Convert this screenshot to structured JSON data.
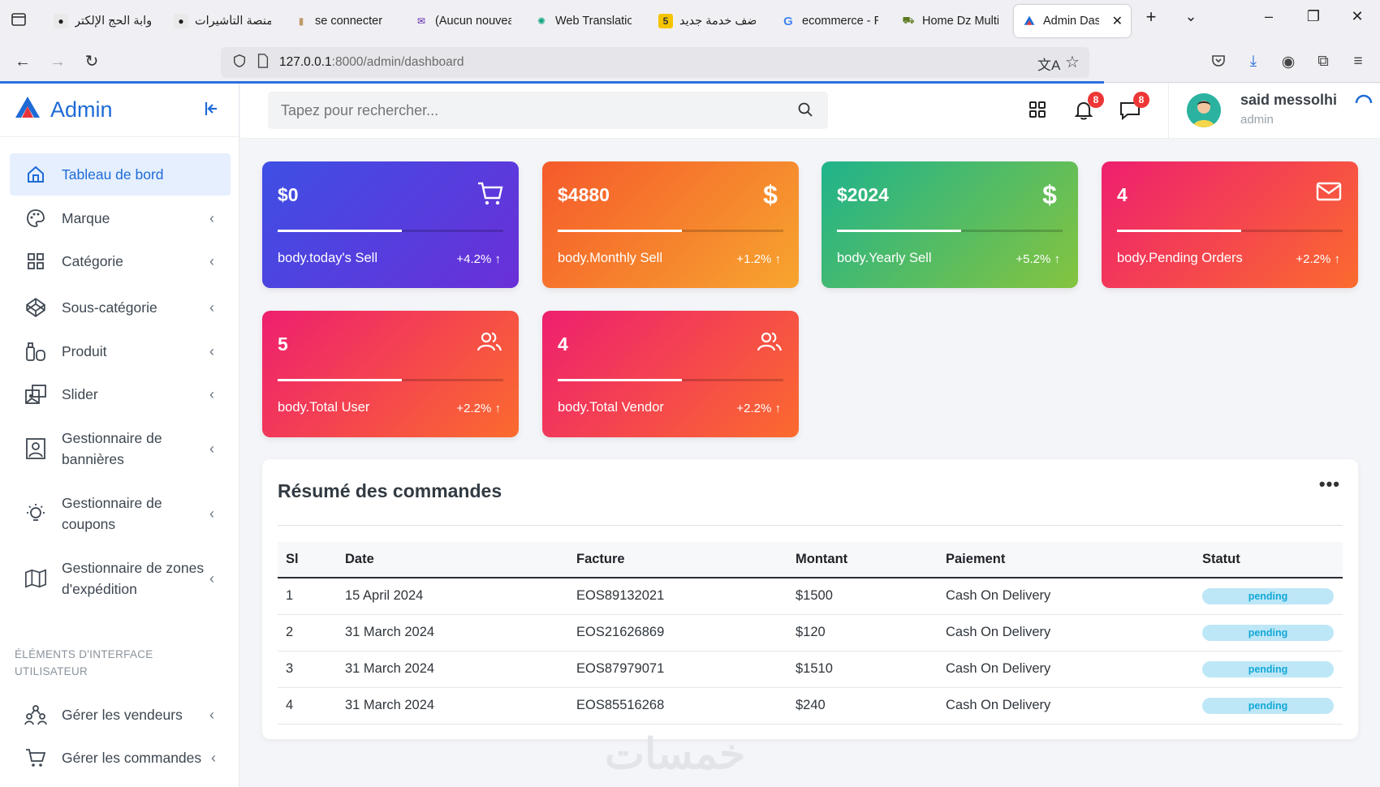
{
  "browser": {
    "tabs": [
      {
        "label": "بوابة الحج الإلكتر",
        "icon": "globe-icon"
      },
      {
        "label": "منصة التأشيرات",
        "icon": "globe-icon"
      },
      {
        "label": "se connecter",
        "icon": "page-icon"
      },
      {
        "label": "(Aucun nouvea",
        "icon": "mail-icon"
      },
      {
        "label": "Web Translation",
        "icon": "chatgpt-icon"
      },
      {
        "label": "أضف خدمة جديد",
        "icon": "khamsat-icon"
      },
      {
        "label": "ecommerce - R",
        "icon": "google-icon"
      },
      {
        "label": "Home Dz Multi",
        "icon": "truck-icon"
      },
      {
        "label": "Admin Dash",
        "icon": "admin-logo-icon"
      }
    ],
    "url_host": "127.0.0.1",
    "url_path": ":8000/admin/dashboard"
  },
  "sidebar": {
    "brand": "Admin",
    "items": [
      {
        "label": "Tableau de bord",
        "icon": "home-icon"
      },
      {
        "label": "Marque",
        "icon": "palette-icon"
      },
      {
        "label": "Catégorie",
        "icon": "grid-icon"
      },
      {
        "label": "Sous-catégorie",
        "icon": "codepen-icon"
      },
      {
        "label": "Produit",
        "icon": "bottles-icon"
      },
      {
        "label": "Slider",
        "icon": "images-icon"
      },
      {
        "label": "Gestionnaire de bannières",
        "icon": "portrait-icon"
      },
      {
        "label": "Gestionnaire de coupons",
        "icon": "bulb-icon"
      },
      {
        "label": "Gestionnaire de zones d'expédition",
        "icon": "map-icon"
      }
    ],
    "section_title": "ÉLÉMENTS D'INTERFACE UTILISATEUR",
    "items2": [
      {
        "label": "Gérer les vendeurs",
        "icon": "users-tree-icon"
      },
      {
        "label": "Gérer les commandes",
        "icon": "cart-icon"
      }
    ]
  },
  "topbar": {
    "search_placeholder": "Tapez pour rechercher...",
    "notifications_count": "8",
    "messages_count": "8",
    "user_name": "said messolhi",
    "user_role": "admin"
  },
  "cards": [
    {
      "value": "$0",
      "label": "body.today's Sell",
      "percent": "+4.2%",
      "icon": "cart-icon",
      "progress": 0.55
    },
    {
      "value": "$4880",
      "label": "body.Monthly Sell",
      "percent": "+1.2%",
      "icon": "dollar-icon",
      "progress": 0.55
    },
    {
      "value": "$2024",
      "label": "body.Yearly Sell",
      "percent": "+5.2%",
      "icon": "dollar-icon",
      "progress": 0.55
    },
    {
      "value": "4",
      "label": "body.Pending Orders",
      "percent": "+2.2%",
      "icon": "mail-icon",
      "progress": 0.55
    },
    {
      "value": "5",
      "label": "body.Total User",
      "percent": "+2.2%",
      "icon": "users-icon",
      "progress": 0.55
    },
    {
      "value": "4",
      "label": "body.Total Vendor",
      "percent": "+2.2%",
      "icon": "users-icon",
      "progress": 0.55
    }
  ],
  "orders": {
    "title": "Résumé des commandes",
    "columns": [
      "Sl",
      "Date",
      "Facture",
      "Montant",
      "Paiement",
      "Statut"
    ],
    "rows": [
      [
        "1",
        "15 April 2024",
        "EOS89132021",
        "$1500",
        "Cash On Delivery",
        "pending"
      ],
      [
        "2",
        "31 March 2024",
        "EOS21626869",
        "$120",
        "Cash On Delivery",
        "pending"
      ],
      [
        "3",
        "31 March 2024",
        "EOS87979071",
        "$1510",
        "Cash On Delivery",
        "pending"
      ],
      [
        "4",
        "31 March 2024",
        "EOS85516268",
        "$240",
        "Cash On Delivery",
        "pending"
      ]
    ]
  },
  "watermark": "خمسات",
  "colors": {
    "accent": "#1e6bd6",
    "badge": "#ee3636",
    "pending_bg": "#bde7f7",
    "pending_text": "#13a8d6"
  }
}
